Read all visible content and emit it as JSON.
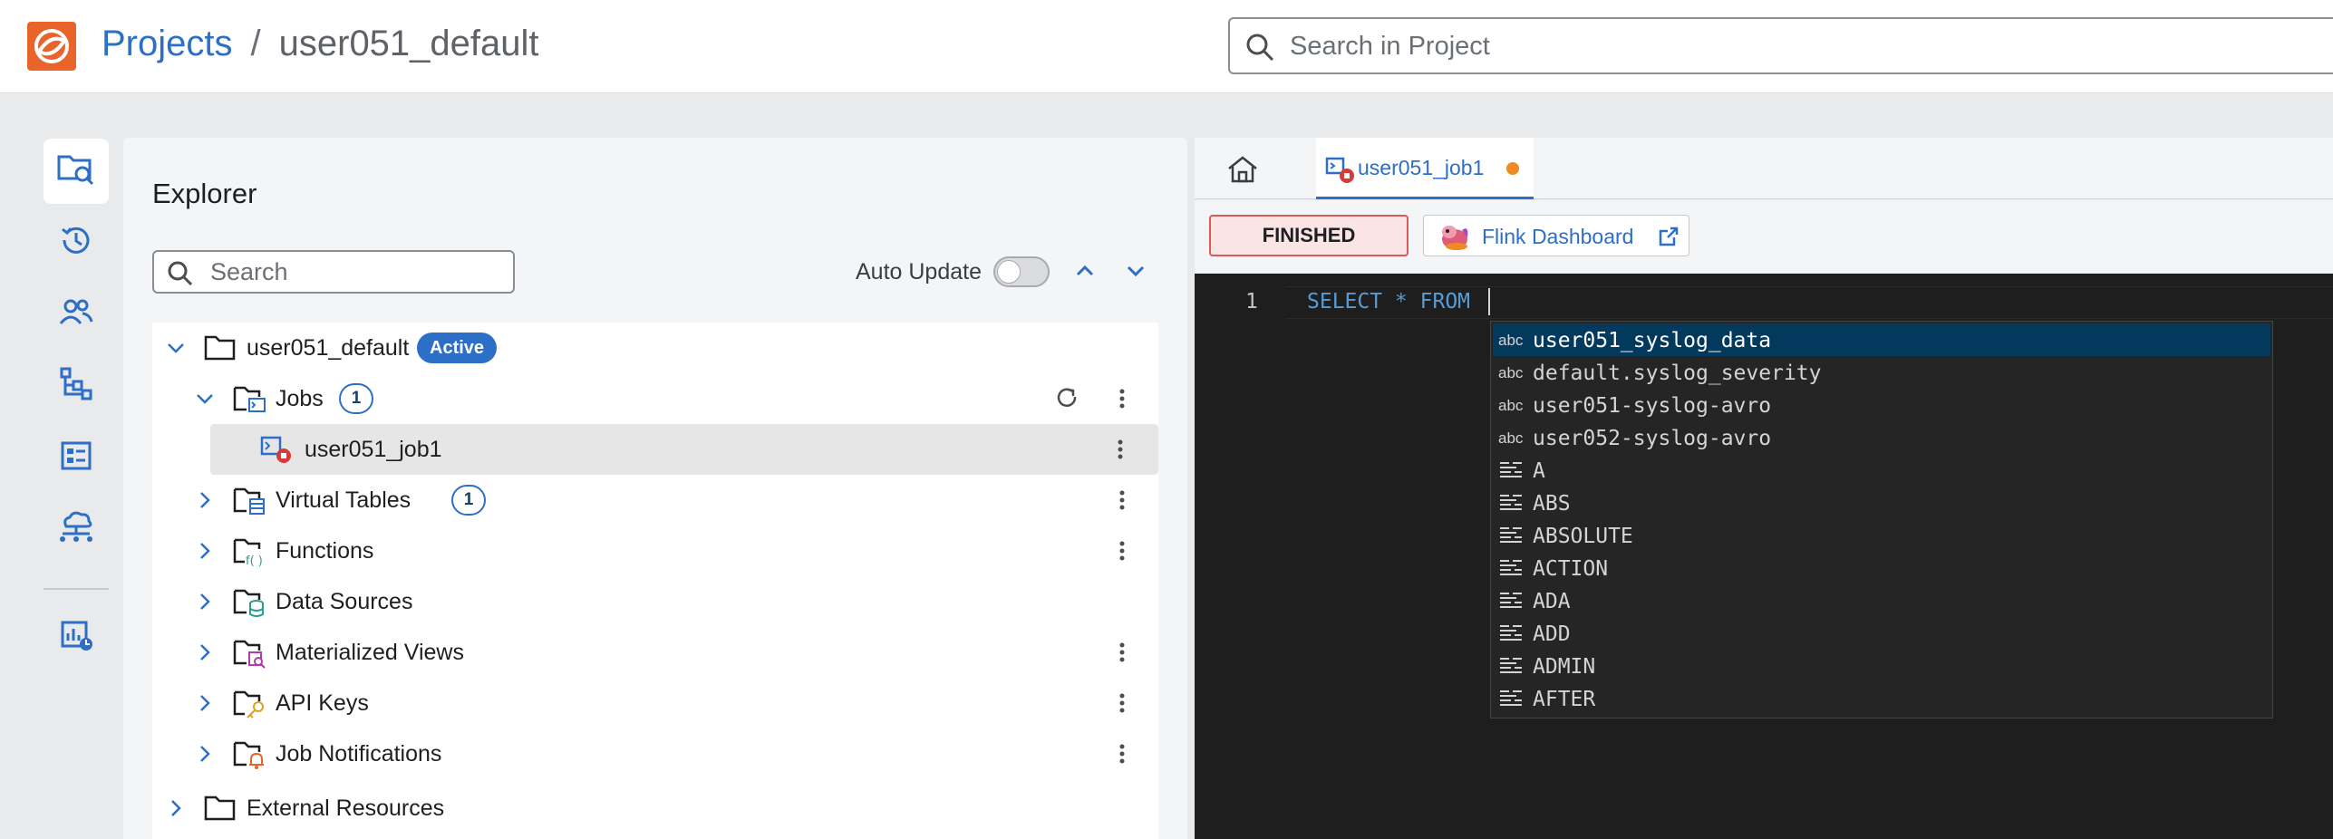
{
  "header": {
    "breadcrumb_projects": "Projects",
    "breadcrumb_separator": "/",
    "breadcrumb_current": "user051_default",
    "search_placeholder": "Search in Project"
  },
  "rail": {
    "items": [
      "explorer-icon",
      "history-icon",
      "users-icon",
      "hierarchy-icon",
      "catalog-icon",
      "cloud-network-icon",
      "monitoring-icon"
    ]
  },
  "explorer": {
    "title": "Explorer",
    "search_placeholder": "Search",
    "auto_update_label": "Auto Update",
    "auto_update_on": false,
    "project": {
      "name": "user051_default",
      "status_badge": "Active"
    },
    "nodes": [
      {
        "label": "Jobs",
        "count": "1",
        "expanded": true
      },
      {
        "label": "user051_job1",
        "selected": true
      },
      {
        "label": "Virtual Tables",
        "count": "1"
      },
      {
        "label": "Functions"
      },
      {
        "label": "Data Sources"
      },
      {
        "label": "Materialized Views"
      },
      {
        "label": "API Keys"
      },
      {
        "label": "Job Notifications"
      },
      {
        "label": "External Resources"
      }
    ]
  },
  "editor": {
    "tab_label": "user051_job1",
    "status": "FINISHED",
    "flink_dashboard_label": "Flink Dashboard",
    "line_number": "1",
    "code_line": "SELECT * FROM",
    "suggestions": [
      {
        "kind": "abc",
        "text": "user051_syslog_data"
      },
      {
        "kind": "abc",
        "text": "default.syslog_severity"
      },
      {
        "kind": "abc",
        "text": "user051-syslog-avro"
      },
      {
        "kind": "abc",
        "text": "user052-syslog-avro"
      },
      {
        "kind": "keyword",
        "text": "A"
      },
      {
        "kind": "keyword",
        "text": "ABS"
      },
      {
        "kind": "keyword",
        "text": "ABSOLUTE"
      },
      {
        "kind": "keyword",
        "text": "ACTION"
      },
      {
        "kind": "keyword",
        "text": "ADA"
      },
      {
        "kind": "keyword",
        "text": "ADD"
      },
      {
        "kind": "keyword",
        "text": "ADMIN"
      },
      {
        "kind": "keyword",
        "text": "AFTER"
      }
    ]
  },
  "colors": {
    "accent": "#2d6fc7",
    "logo": "#e8642b",
    "status_failed_border": "#d85a5a",
    "unsaved_dot": "#f08a24",
    "editor_bg": "#1e1e1e"
  }
}
